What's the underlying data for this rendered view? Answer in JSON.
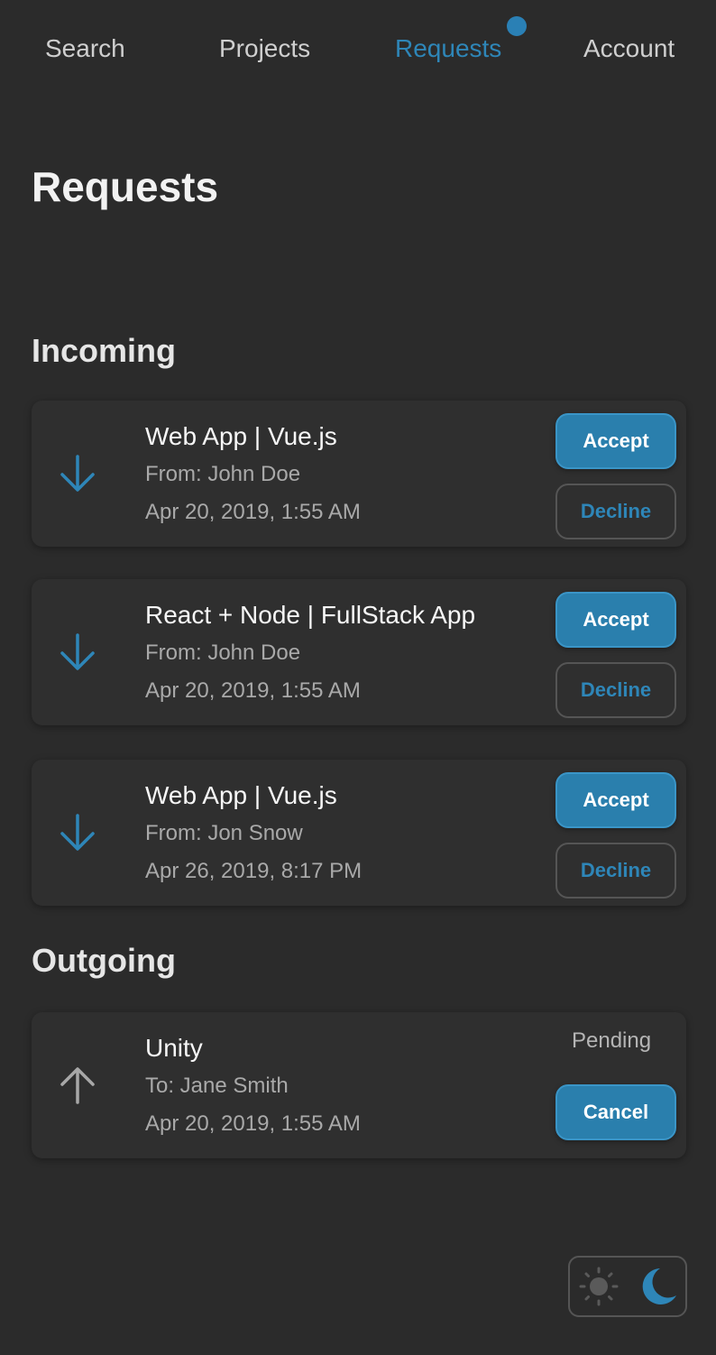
{
  "nav": {
    "items": [
      {
        "label": "Search"
      },
      {
        "label": "Projects"
      },
      {
        "label": "Requests",
        "active": true
      },
      {
        "label": "Account"
      }
    ],
    "accent_color": "#2e86b8"
  },
  "page_title": "Requests",
  "incoming": {
    "title": "Incoming",
    "requests": [
      {
        "title": "Web App | Vue.js",
        "from": "From: John Doe",
        "date": "Apr 20, 2019, 1:55 AM",
        "accept_label": "Accept",
        "decline_label": "Decline"
      },
      {
        "title": "React + Node | FullStack App",
        "from": "From: John Doe",
        "date": "Apr 20, 2019, 1:55 AM",
        "accept_label": "Accept",
        "decline_label": "Decline"
      },
      {
        "title": "Web App | Vue.js",
        "from": "From: Jon Snow",
        "date": "Apr 26, 2019, 8:17 PM",
        "accept_label": "Accept",
        "decline_label": "Decline"
      }
    ]
  },
  "outgoing": {
    "title": "Outgoing",
    "requests": [
      {
        "title": "Unity",
        "to": "To: Jane Smith",
        "date": "Apr 20, 2019, 1:55 AM",
        "status": "Pending",
        "cancel_label": "Cancel"
      }
    ]
  },
  "theme_toggle": {
    "options": [
      "sun-icon",
      "moon-icon"
    ],
    "selected": "dark"
  }
}
